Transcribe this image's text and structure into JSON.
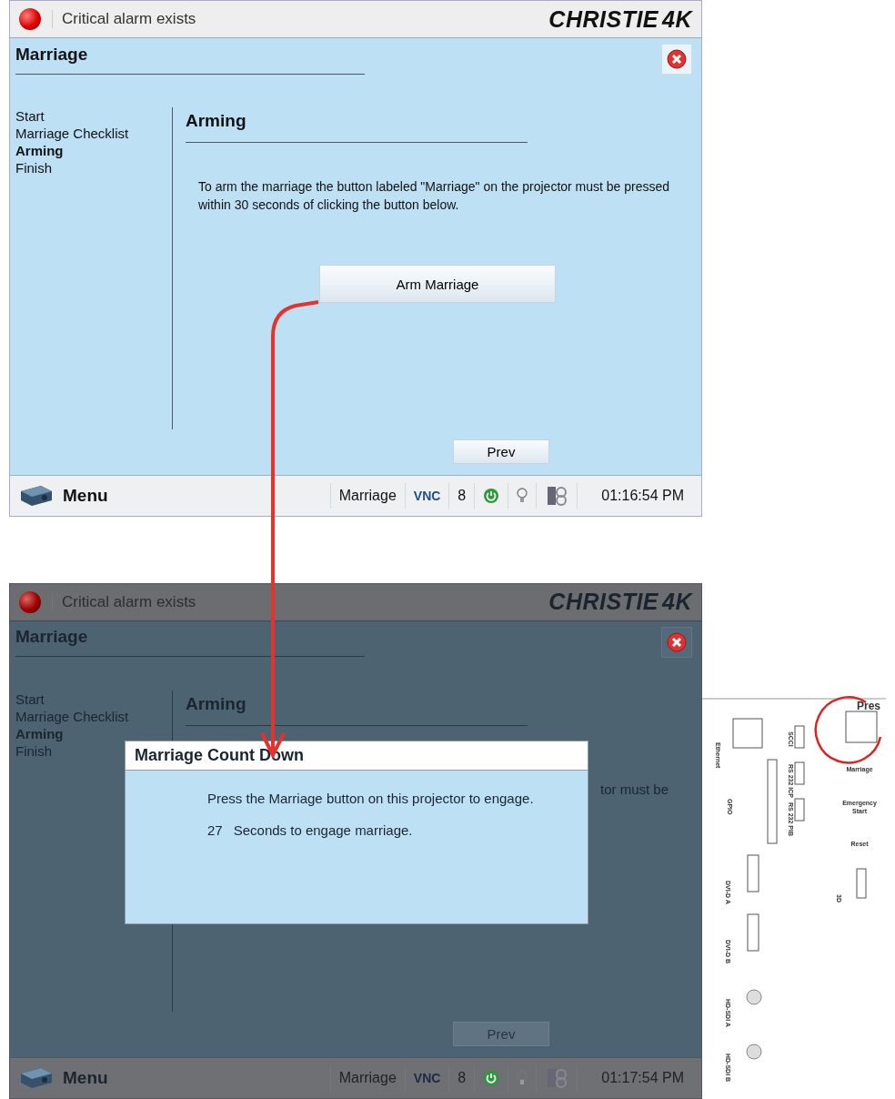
{
  "screens": [
    {
      "dimmed": false,
      "alarm_text": "Critical alarm exists",
      "brand": "CHRISTIE",
      "brand_suffix": "4K",
      "title": "Marriage",
      "steps": [
        {
          "label": "Start",
          "selected": false
        },
        {
          "label": "Marriage Checklist",
          "selected": false
        },
        {
          "label": "Arming",
          "selected": true
        },
        {
          "label": "Finish",
          "selected": false
        }
      ],
      "heading": "Arming",
      "instruction": "To arm the marriage the button labeled \"Marriage\" on the projector must be pressed within 30 seconds of clicking the button below.",
      "action_button": "Arm Marriage",
      "prev_button": "Prev",
      "taskbar": {
        "menu": "Menu",
        "mode": "Marriage",
        "vnc": "VNC",
        "count": "8",
        "time": "01:16:54 PM"
      }
    },
    {
      "dimmed": true,
      "alarm_text": "Critical alarm exists",
      "brand": "CHRISTIE",
      "brand_suffix": "4K",
      "title": "Marriage",
      "steps": [
        {
          "label": "Start",
          "selected": false
        },
        {
          "label": "Marriage Checklist",
          "selected": false
        },
        {
          "label": "Arming",
          "selected": true
        },
        {
          "label": "Finish",
          "selected": false
        }
      ],
      "heading": "Arming",
      "instruction_fragment": "tor must be",
      "prev_button": "Prev",
      "taskbar": {
        "menu": "Menu",
        "mode": "Marriage",
        "vnc": "VNC",
        "count": "8",
        "time": "01:17:54 PM"
      },
      "dialog": {
        "title": "Marriage Count Down",
        "message": "Press the Marriage button on this projector to engage.",
        "countdown": "27",
        "countdown_label": "Seconds to engage marriage."
      }
    }
  ],
  "rear_panel": {
    "callout": "Pres",
    "labels": [
      "Ethernet",
      "SCCI",
      "RS 232 ICP",
      "RS 232 PIB",
      "GPIO",
      "DVI-D A",
      "DVI-D B",
      "HD-SDI A",
      "HD-SDI B",
      "Marriage",
      "Emergency",
      "Start",
      "Reset",
      "3D"
    ]
  }
}
